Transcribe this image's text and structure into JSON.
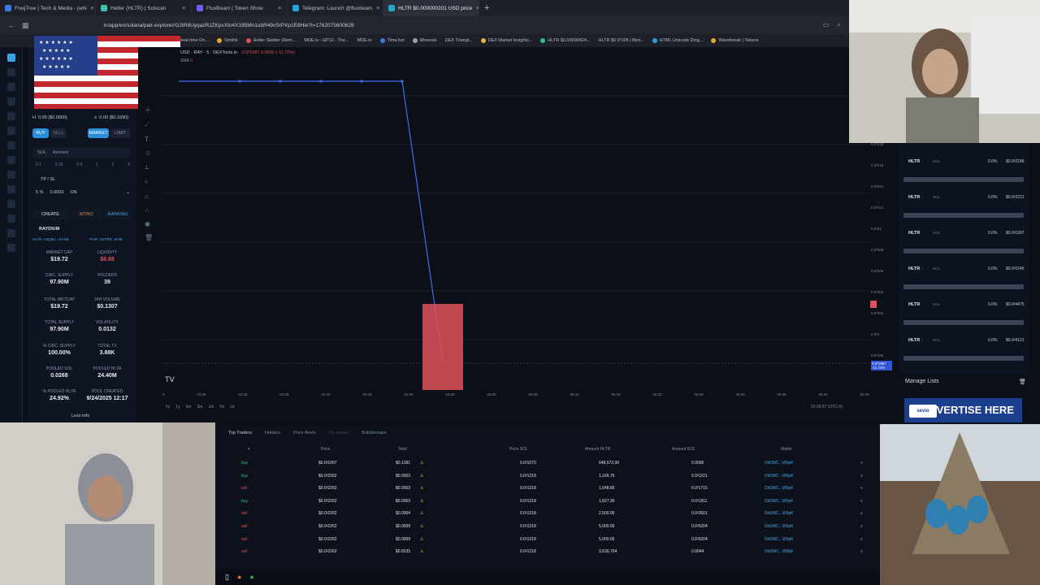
{
  "browser": {
    "tabs": [
      {
        "label": "FreqTree | Tech & Media - (whi",
        "active": false
      },
      {
        "label": "Helter (HLTR) | Solscan",
        "active": false
      },
      {
        "label": "FluxBeam | Token Show",
        "active": false
      },
      {
        "label": "Telegram: Launch @fluxbeam",
        "active": false
      },
      {
        "label": "HLTR $0.000000201 USD price",
        "active": true
      }
    ],
    "url": "in/app/en/solana/pair-explorer/G2tR8UyqazRJZKpxXtn4X195Mn1ubR49vSrPXp1E8Hie?t=1762075600628",
    "bookmarks": [
      "Real-time On...",
      "Smithii",
      "Helter Skelter (Rem...",
      "MDE.tv - EP12 - The...",
      "MDE.tv",
      "Time.fun",
      "Minerals",
      "DEX Triangl...",
      "DEX Market Insights...",
      "HLTR $0.00000424...",
      "HLTR $0.0²106 | Bird...",
      "HTML Unicode Ding...",
      "Wavebreak | Tokens"
    ]
  },
  "chart_header": "USD · RAY · 5 · DEXTools.io",
  "chart_header_change": "0.0²1997  0.0000 (-11.72%)",
  "chart_indicator": "SMA",
  "trade_panel": {
    "price_usd": "0.00 ($0.0000)",
    "price_sol": "0.00 ($0.1690)",
    "buy_label": "BUY",
    "sell_label": "SELL",
    "market_label": "MARKET",
    "limit_label": "LIMIT",
    "currency": "SOL",
    "amount_placeholder": "Amount",
    "presets": [
      "0.1",
      "0.25",
      "0.5",
      "1",
      "2",
      "5"
    ],
    "tpsl_label": "TP / SL",
    "slippage": "5 %",
    "fee": "0.0003",
    "toggle": "ON"
  },
  "tags": [
    "CREATE",
    "NITRO",
    "RANKING"
  ],
  "dex": "RAYDIUM",
  "pair_left": "HLTR: A3QMJ...NYNE",
  "pair_right": "PAIR: G2TR8...8HIE",
  "stats": [
    {
      "label": "MARKET CAP",
      "value": "$19.72",
      "red": false
    },
    {
      "label": "LIQUIDITY",
      "value": "$8.88",
      "red": true
    },
    {
      "label": "CIRC. SUPPLY",
      "value": "97.90M",
      "red": false
    },
    {
      "label": "HOLDERS",
      "value": "39",
      "red": false
    },
    {
      "label": "TOTAL MKTCAP",
      "value": "$19.72",
      "red": false
    },
    {
      "label": "24H VOLUME",
      "value": "$0.1307",
      "red": false
    },
    {
      "label": "TOTAL SUPPLY",
      "value": "97.90M",
      "red": false
    },
    {
      "label": "VOLATILITY",
      "value": "0.0132",
      "red": false
    },
    {
      "label": "% CIRC. SUPPLY",
      "value": "100.00%",
      "red": false
    },
    {
      "label": "TOTAL TX",
      "value": "3.88K",
      "red": false
    },
    {
      "label": "POOLED SOL",
      "value": "0.0268",
      "red": false
    },
    {
      "label": "POOLED HLTR",
      "value": "24.40M",
      "red": false
    },
    {
      "label": "% POOLED HLTR",
      "value": "24.92%",
      "red": false
    },
    {
      "label": "POOL CREATED",
      "value": "9/24/2025 12:17",
      "red": false
    }
  ],
  "less_info": "Less info",
  "y_ticks": [
    "0.0²218",
    "0.0²216",
    "0.0²214",
    "0.0²212",
    "0.0²21",
    "0.0²208",
    "0.0²206",
    "0.0²204",
    "0.0²202",
    "0.0²2",
    "0.0²198"
  ],
  "x_ticks": [
    "0",
    "04:25",
    "04:30",
    "04:35",
    "04:40",
    "04:45",
    "04:50",
    "04:55",
    "05:00",
    "05:05",
    "05:10",
    "05:15",
    "05:20",
    "05:25",
    "05:30",
    "05:35",
    "05:40",
    "05:45"
  ],
  "timeframes": [
    "5y",
    "1y",
    "6m",
    "3m",
    "1m",
    "5d",
    "1d"
  ],
  "utc_time": "03:26:57 (UTC-6)",
  "price_tag": "0.0²1997 -11.72%",
  "watchlist": [
    {
      "symbol": "HLTR",
      "pair": "SOL",
      "pct": "0.0%",
      "price": "$0.0²2186"
    },
    {
      "symbol": "HLTR",
      "pair": "SOL",
      "pct": "0.0%",
      "price": "$0.0²2221"
    },
    {
      "symbol": "HLTR",
      "pair": "SOL",
      "pct": "0.0%",
      "price": "$0.0²1997"
    },
    {
      "symbol": "HLTR",
      "pair": "SOL",
      "pct": "0.0%",
      "price": "$0.0²1545"
    },
    {
      "symbol": "HLTR",
      "pair": "SOL",
      "pct": "0.0%",
      "price": "$0.0²4475"
    },
    {
      "symbol": "HLTR",
      "pair": "SOL",
      "pct": "0.0%",
      "price": "$0.0²4121"
    }
  ],
  "manage_lists": "Manage Lists",
  "advert": {
    "sponsor": "sevio",
    "text": "ADVERTISE HERE"
  },
  "trade_tabs": [
    "Top Traders",
    "Holders",
    "Price Alerts",
    "My swaps",
    "Bubblemaps"
  ],
  "trade_columns": [
    "Price",
    "Total",
    "Price SOL",
    "Amount HLTR",
    "Amount SOL",
    "Maker"
  ],
  "trades": [
    {
      "type": "buy",
      "price": "$0.0²1997",
      "total": "$0.1281",
      "price_sol": "0.0²1073",
      "amount": "648,572.00",
      "amount_sol": "0.0006",
      "maker": "DbDMC...W9pK"
    },
    {
      "type": "buy",
      "price": "$0.0²2262",
      "total": "$0.0003",
      "price_sol": "0.0²1218",
      "amount": "1,166.76",
      "amount_sol": "0.0²1221",
      "maker": "DbDMC...W9pK"
    },
    {
      "type": "sell",
      "price": "$0.0²2262",
      "total": "$0.0003",
      "price_sol": "0.0²1218",
      "amount": "1,648.85",
      "amount_sol": "0.0²1715",
      "maker": "DbDMC...W9pK"
    },
    {
      "type": "buy",
      "price": "$0.0²2262",
      "total": "$0.0003",
      "price_sol": "0.0²1218",
      "amount": "1,827.30",
      "amount_sol": "0.0²1911",
      "maker": "DbDMC...W9pK"
    },
    {
      "type": "sell",
      "price": "$0.0²2262",
      "total": "$0.0004",
      "price_sol": "0.0²1218",
      "amount": "2,500.00",
      "amount_sol": "0.0²2601",
      "maker": "DbDMC...W9pK"
    },
    {
      "type": "sell",
      "price": "$0.0²2262",
      "total": "$0.0009",
      "price_sol": "0.0²1218",
      "amount": "5,000.00",
      "amount_sol": "0.0²5204",
      "maker": "DbDMC...W9pK"
    },
    {
      "type": "sell",
      "price": "$0.0²2262",
      "total": "$0.0009",
      "price_sol": "0.0²1218",
      "amount": "5,000.00",
      "amount_sol": "0.0²5204",
      "maker": "DbDMC...W9pK"
    },
    {
      "type": "sell",
      "price": "$0.0²2262",
      "total": "$0.8235",
      "price_sol": "0.0²1218",
      "amount": "3,630,704",
      "amount_sol": "0.0044",
      "maker": "DbDMC...W9pK"
    }
  ]
}
